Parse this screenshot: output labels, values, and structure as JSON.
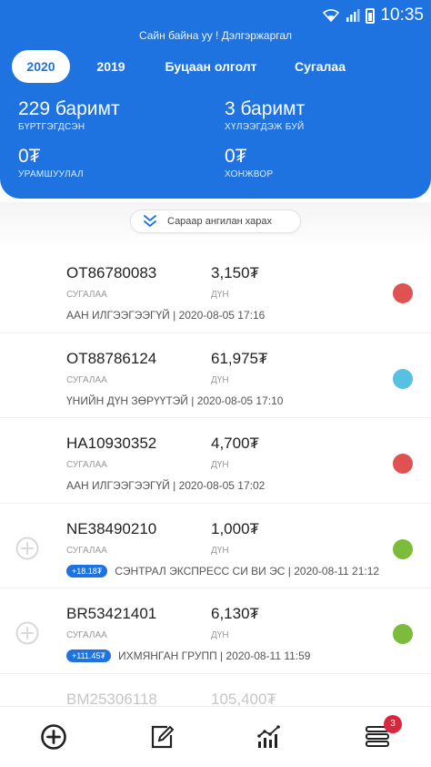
{
  "status_bar": {
    "time": "10:35"
  },
  "greeting": "Сайн байна уу ! Дэлгэржаргал",
  "tabs": [
    {
      "label": "2020"
    },
    {
      "label": "2019"
    },
    {
      "label": "Буцаан олголт"
    },
    {
      "label": "Сугалаа"
    }
  ],
  "stats": {
    "registered": {
      "value": "229 баримт",
      "label": "БҮРТГЭГДСЭН"
    },
    "pending": {
      "value": "3 баримт",
      "label": "ХҮЛЭЭГДЭЖ БУЙ"
    },
    "bonus": {
      "value": "0₮",
      "label": "УРАМШУУЛАЛ"
    },
    "discount": {
      "value": "0₮",
      "label": "ХОНЖВОР"
    }
  },
  "filter": {
    "label": "Сараар ангилан харах"
  },
  "receipts": [
    {
      "code": "OT86780083",
      "amount": "3,150₮",
      "type": "СУГАЛАА",
      "amount_label": "ДҮН",
      "info": "ААН ИЛГЭЭГЭЭГҮЙ | 2020-08-05 17:16",
      "badge": "",
      "status_color": "#e05252"
    },
    {
      "code": "OT88786124",
      "amount": "61,975₮",
      "type": "СУГАЛАА",
      "amount_label": "ДҮН",
      "info": "ҮНИЙН ДҮН ЗӨРҮҮТЭЙ | 2020-08-05 17:10",
      "badge": "",
      "status_color": "#56c1e3"
    },
    {
      "code": "HA10930352",
      "amount": "4,700₮",
      "type": "СУГАЛАА",
      "amount_label": "ДҮН",
      "info": "ААН ИЛГЭЭГЭЭГҮЙ | 2020-08-05 17:02",
      "badge": "",
      "status_color": "#e05252"
    },
    {
      "code": "NE38490210",
      "amount": "1,000₮",
      "type": "СУГАЛАА",
      "amount_label": "ДҮН",
      "info": "СЭНТРАЛ ЭКСПРЕСС СИ ВИ ЭС | 2020-08-11 21:12",
      "badge": "+18.18₮",
      "status_color": "#7cbb3b"
    },
    {
      "code": "BR53421401",
      "amount": "6,130₮",
      "type": "СУГАЛАА",
      "amount_label": "ДҮН",
      "info": "ИХМЯНГАН ГРУПП | 2020-08-11 11:59",
      "badge": "+111.45₮",
      "status_color": "#7cbb3b"
    }
  ],
  "partial_row": {
    "code": "BM25306118",
    "amount": "105,400₮"
  },
  "bottom_nav": {
    "items": [
      {
        "icon": "add-circle-icon"
      },
      {
        "icon": "edit-icon"
      },
      {
        "icon": "chart-icon"
      },
      {
        "icon": "list-stack-icon"
      }
    ],
    "badge_count": "3"
  },
  "colors": {
    "primary": "#1e73e0",
    "red": "#e05252",
    "cyan": "#56c1e3",
    "green": "#7cbb3b",
    "badge": "#d8283e"
  }
}
